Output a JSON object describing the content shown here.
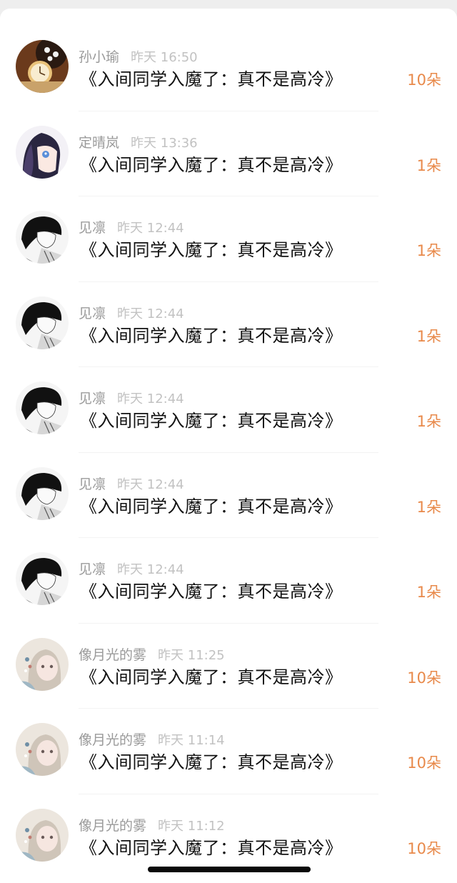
{
  "records": [
    {
      "name": "孙小瑜",
      "time": "昨天 16:50",
      "gift": "《入间同学入魔了：真不是高冷》",
      "count": "10朵",
      "avatar": "pocket-watch-avatar"
    },
    {
      "name": "定晴岚",
      "time": "昨天 13:36",
      "gift": "《入间同学入魔了：真不是高冷》",
      "count": "1朵",
      "avatar": "anime-girl-avatar"
    },
    {
      "name": "见凛",
      "time": "昨天 12:44",
      "gift": "《入间同学入魔了：真不是高冷》",
      "count": "1朵",
      "avatar": "monochrome-boy-avatar"
    },
    {
      "name": "见凛",
      "time": "昨天 12:44",
      "gift": "《入间同学入魔了：真不是高冷》",
      "count": "1朵",
      "avatar": "monochrome-boy-avatar"
    },
    {
      "name": "见凛",
      "time": "昨天 12:44",
      "gift": "《入间同学入魔了：真不是高冷》",
      "count": "1朵",
      "avatar": "monochrome-boy-avatar"
    },
    {
      "name": "见凛",
      "time": "昨天 12:44",
      "gift": "《入间同学入魔了：真不是高冷》",
      "count": "1朵",
      "avatar": "monochrome-boy-avatar"
    },
    {
      "name": "见凛",
      "time": "昨天 12:44",
      "gift": "《入间同学入魔了：真不是高冷》",
      "count": "1朵",
      "avatar": "monochrome-boy-avatar"
    },
    {
      "name": "像月光的雾",
      "time": "昨天 11:25",
      "gift": "《入间同学入魔了：真不是高冷》",
      "count": "10朵",
      "avatar": "pastel-girl-avatar"
    },
    {
      "name": "像月光的雾",
      "time": "昨天 11:14",
      "gift": "《入间同学入魔了：真不是高冷》",
      "count": "10朵",
      "avatar": "pastel-girl-avatar"
    },
    {
      "name": "像月光的雾",
      "time": "昨天 11:12",
      "gift": "《入间同学入魔了：真不是高冷》",
      "count": "10朵",
      "avatar": "pastel-girl-avatar"
    }
  ],
  "colors": {
    "name": "#9a9a9a",
    "time": "#c2c2c2",
    "gift": "#111111",
    "count": "#e8894a",
    "background": "#ffffff"
  }
}
